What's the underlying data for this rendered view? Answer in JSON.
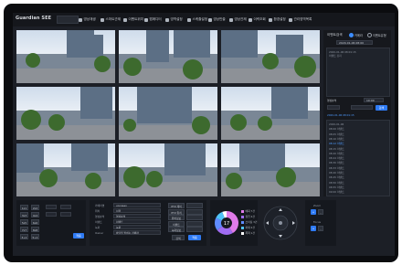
{
  "app": {
    "brand": "Guardian SEE"
  },
  "nav": [
    {
      "label": "영상재생",
      "icon": "play-icon"
    },
    {
      "label": "스마트관제",
      "icon": "monitor-icon"
    },
    {
      "label": "이벤트위치",
      "icon": "location-icon"
    },
    {
      "label": "맵에디터",
      "icon": "map-icon"
    },
    {
      "label": "영역설정",
      "icon": "area-icon"
    },
    {
      "label": "스케줄설정",
      "icon": "schedule-icon"
    },
    {
      "label": "영상반출",
      "icon": "export-icon"
    },
    {
      "label": "영상관제",
      "icon": "lock-icon"
    },
    {
      "label": "이력조회",
      "icon": "history-icon"
    },
    {
      "label": "환경설정",
      "icon": "gear-icon"
    },
    {
      "label": "관리영역목록",
      "icon": "list-icon"
    }
  ],
  "side": {
    "title": "이벤트검색",
    "radio_a": "카메라",
    "radio_b": "이벤트유형",
    "date_field": "2020-01-06 08:00",
    "filter_label": "영상분석",
    "filter_value": "10:00",
    "search": "검색",
    "list_a": [
      "2020-01-06 08:01:15",
      "이벤트 감지"
    ],
    "list_b": [
      "2020-01-06",
      "08:00 이벤트",
      "08:05 이벤트",
      "08:10 이벤트",
      "08:12 이벤트",
      "08:15 이벤트",
      "08:20 이벤트",
      "08:24 이벤트",
      "08:30 이벤트",
      "08:33 이벤트",
      "08:40 이벤트",
      "08:45 이벤트",
      "08:50 이벤트",
      "08:55 이벤트",
      "09:00 이벤트"
    ],
    "selected_index": 4
  },
  "layout_panel": {
    "buttons": [
      "1x1",
      "2x2",
      "3x3",
      "4x4",
      "5x5",
      "6x6",
      "7x7",
      "8x8",
      "3+1",
      "5+1"
    ],
    "apply": "적용"
  },
  "info_panel": {
    "labels": [
      "카메라명",
      "위치",
      "영상분석",
      "이벤트",
      "녹화",
      "Owner"
    ],
    "values": [
      "yongsan",
      "서울",
      "영상분석",
      "이벤트",
      "녹화",
      "바닥을 밝히는 카메라"
    ],
    "right_buttons": [
      "PTZ 제어",
      "PTZ 위치",
      "위치정보",
      "이벤트",
      "녹화정보"
    ],
    "footer": [
      "검색",
      "적용"
    ]
  },
  "stats": {
    "legend": [
      "배회 7건",
      "침입 4건",
      "쓰러짐 3건",
      "화재 2건",
      "폭력 1건"
    ],
    "colors": [
      "#e07be8",
      "#a06cf2",
      "#5f8cff",
      "#4fc3f7",
      "#ffffff"
    ],
    "values": [
      7,
      4,
      3,
      2,
      1
    ],
    "center": "17"
  },
  "ptz": {
    "label_a": "Zoom",
    "label_b": "Focus"
  }
}
